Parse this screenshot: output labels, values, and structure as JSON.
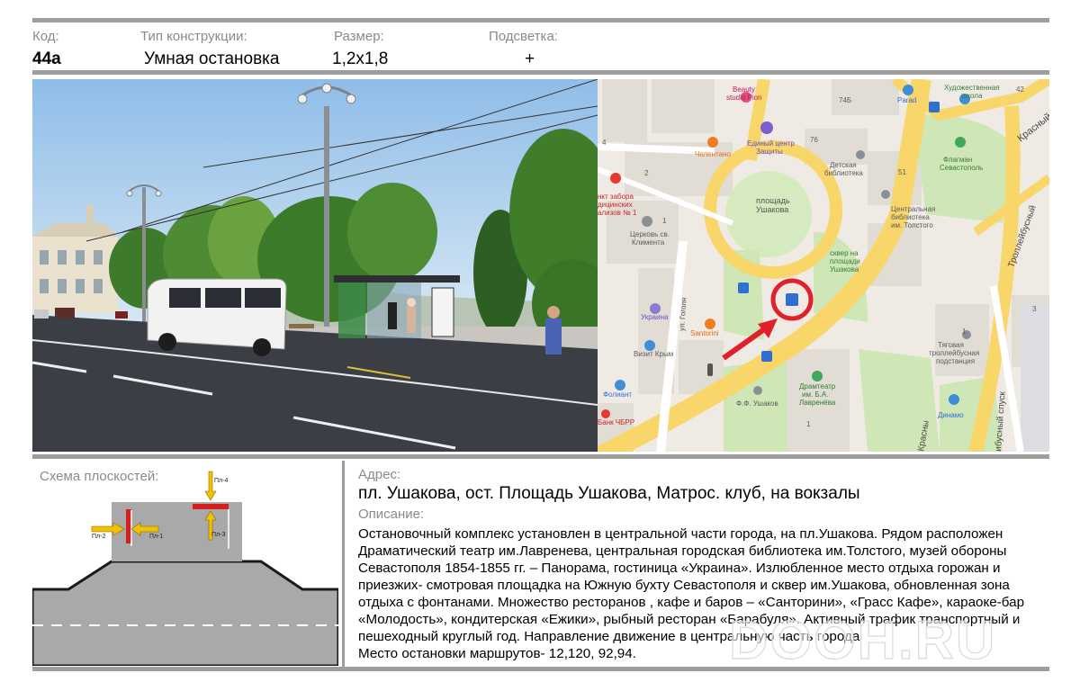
{
  "header": {
    "code_label": "Код:",
    "code_value": "44а",
    "type_label": "Тип конструкции:",
    "type_value": "Умная остановка",
    "size_label": "Размер:",
    "size_value": "1,2х1,8",
    "light_label": "Подсветка:",
    "light_value": "+"
  },
  "map": {
    "labels": {
      "beauty": "Beauty",
      "beauty2": "studio Pion",
      "n74b": "74Б",
      "parad": "Parad",
      "art": "Художественная",
      "art2": "школа",
      "n42": "42",
      "krasny_top": "Красный",
      "n4": "4",
      "chelentano": "Челентано",
      "center": "Единый центр",
      "center2": "Защиты",
      "n76": "76",
      "kids_lib": "Детская",
      "kids_lib2": "библиотека",
      "flagman": "Флагман",
      "flagman2": "Севастополь",
      "n2": "2",
      "n51": "51",
      "punkt1": "нкт забора",
      "punkt2": "дицинских",
      "punkt3": "ализов № 1",
      "sq1": "площадь",
      "sq2": "Ушакова",
      "clib1": "Центральная",
      "clib2": "библиотека",
      "clib3": "им. Толстого",
      "trolley_road": "Троллейбусный",
      "church1": "Церковь св.",
      "church2": "Климента",
      "n1a": "1",
      "park1": "сквер на",
      "park2": "площади",
      "park3": "Ушакова",
      "gogol": "ул. Гоголя",
      "ukraina": "Украина",
      "santorini": "Santorini",
      "n3": "3",
      "viz": "Визит Крым",
      "sub1": "Тяговая",
      "sub2": "троллейбусная",
      "sub3": "подстанция",
      "n1b": "1",
      "spusk": "ибусный спуск",
      "folio": "Фолиант",
      "theatre1": "Драмтеатр",
      "theatre2": "им. Б.А.",
      "theatre3": "Лавренёва",
      "ushakov": "Ф.Ф. Ушаков",
      "bank": "Банк ЧБРР",
      "n1c": "1",
      "dinamo": "Динамо",
      "krasny_bottom": "Красны"
    }
  },
  "scheme": {
    "title": "Схема плоскостей:",
    "p1": "Пл-1",
    "p2": "Пл-2",
    "p3": "Пл-3",
    "p4": "Пл-4"
  },
  "address": {
    "label": "Адрес:",
    "value": "пл. Ушакова, ост. Площадь Ушакова, Матрос. клуб, на вокзалы"
  },
  "description": {
    "label": "Описание:",
    "lines": [
      "Остановочный комплекс  установлен в центральной части  города, на пл.Ушакова. Рядом расположен",
      "Драматический театр им.Лавренева,  центральная городская библиотека им.Толстого, музей обороны",
      "Севастополя 1854-1855 гг. – Панорама, гостиница «Украина». Излюбленное место отдыха горожан и",
      "приезжих- смотровая площадка на Южную бухту Севастополя и сквер им.Ушакова, обновленная зона",
      "отдыха с фонтанами. Множество ресторанов , кафе и баров – «Санторини», «Грасс Кафе», караоке-бар",
      "«Молодость», кондитерская «Ежики»,  рыбный ресторан «Барабуля». Активный трафик транспортный и",
      "пешеходный круглый год. Направление движение в центральную  часть города",
      "Место остановки маршрутов- 12,120, 92,94."
    ]
  },
  "watermark": "DOOH.RU",
  "colors": {
    "rule": "#9e9e9e",
    "label_gray": "#8a8a8a",
    "marker_red": "#e0202a",
    "plane_red": "#d62020",
    "arrow_yellow": "#f2c100",
    "road_gray": "#a9a9a9",
    "map_road_yellow": "#f8d66a"
  }
}
